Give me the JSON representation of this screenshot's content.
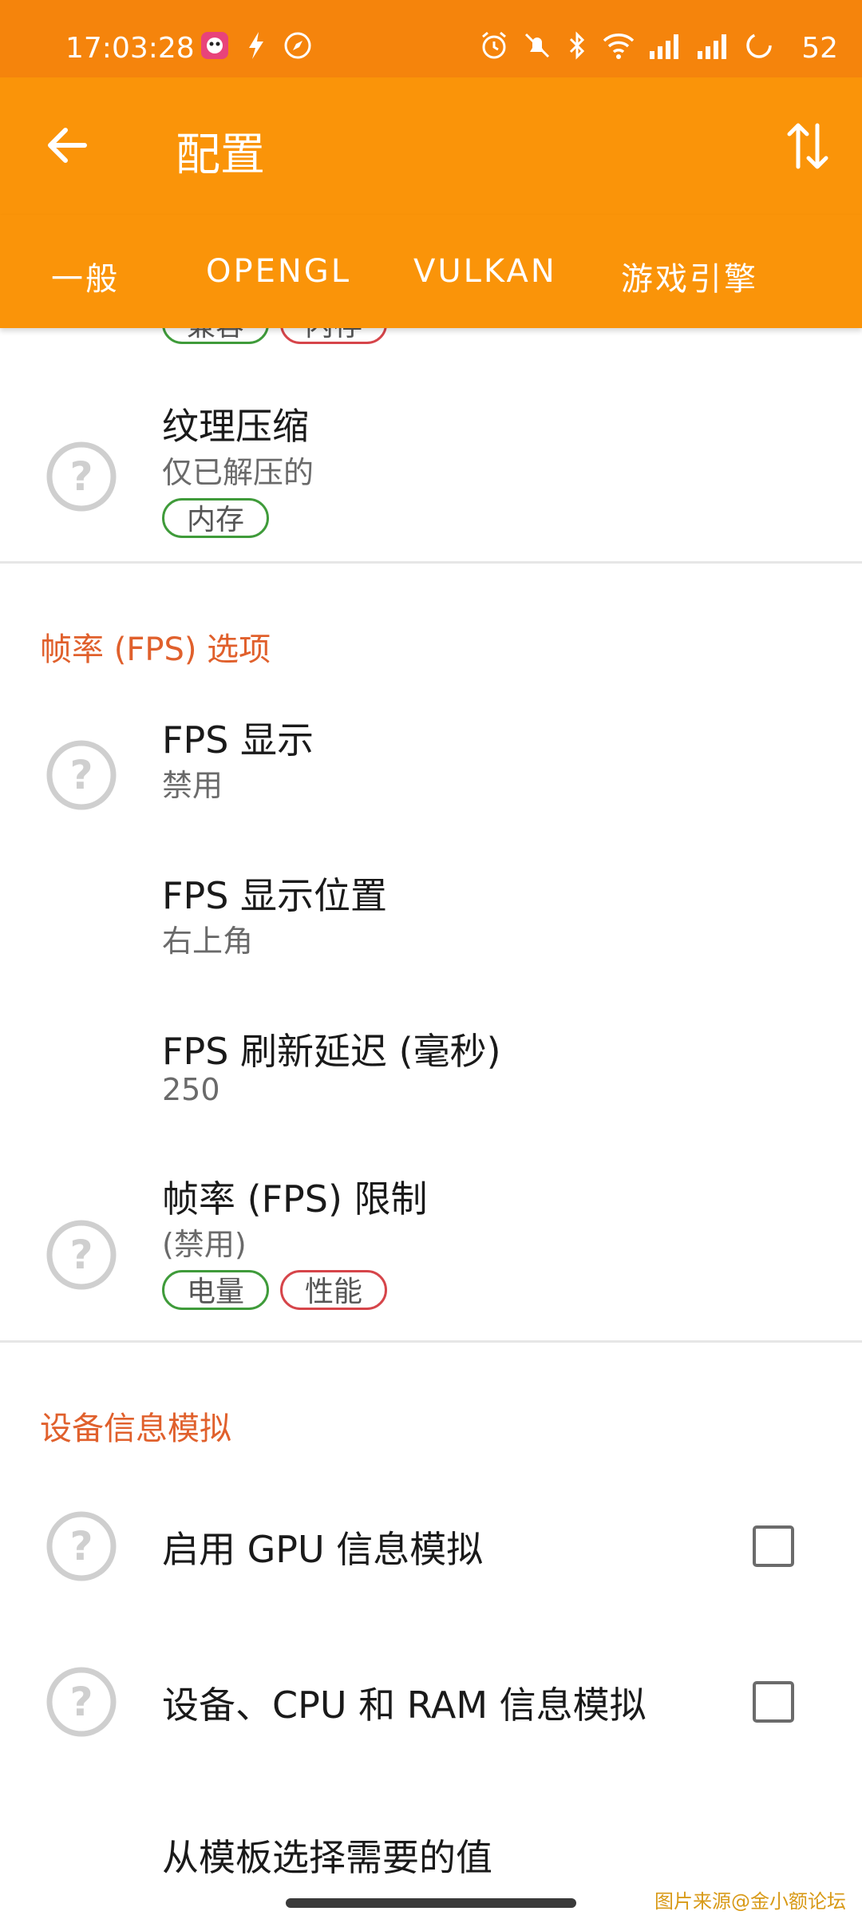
{
  "status_bar": {
    "time": "17:03:28",
    "battery": "52",
    "icons": [
      "app-notification-icon",
      "flash-icon",
      "compass-icon",
      "alarm-icon",
      "mute-icon",
      "bluetooth-icon",
      "wifi-icon",
      "signal-icon",
      "signal-icon",
      "battery-ring-icon"
    ]
  },
  "app_bar": {
    "title": "配置"
  },
  "tabs": [
    {
      "label": "一般"
    },
    {
      "label": "OPENGL"
    },
    {
      "label": "VULKAN"
    },
    {
      "label": "游戏引擎"
    }
  ],
  "top_partial": {
    "chips": [
      {
        "label": "兼容",
        "tone": "green"
      },
      {
        "label": "内存",
        "tone": "red"
      }
    ]
  },
  "texture_compression": {
    "title": "纹理压缩",
    "value": "仅已解压的",
    "chips": [
      {
        "label": "内存",
        "tone": "green"
      }
    ]
  },
  "fps_section": {
    "header": "帧率 (FPS) 选项",
    "items": [
      {
        "title": "FPS 显示",
        "value": "禁用"
      },
      {
        "title": "FPS 显示位置",
        "value": "右上角"
      },
      {
        "title": "FPS 刷新延迟 (毫秒)",
        "value": "250"
      },
      {
        "title": "帧率 (FPS) 限制",
        "value": "(禁用)",
        "chips": [
          {
            "label": "电量",
            "tone": "green"
          },
          {
            "label": "性能",
            "tone": "red"
          }
        ]
      }
    ]
  },
  "device_section": {
    "header": "设备信息模拟",
    "items": [
      {
        "title": "启用 GPU 信息模拟",
        "checked": false
      },
      {
        "title": "设备、CPU 和 RAM 信息模拟",
        "checked": false
      },
      {
        "title": "从模板选择需要的值"
      }
    ]
  },
  "watermark": "图片来源@金小额论坛",
  "colors": {
    "status_bar": "#f5840c",
    "app_bar": "#fa9409",
    "section_header": "#e0602c",
    "chip_green": "#3f9b3a",
    "chip_red": "#d6454a"
  }
}
